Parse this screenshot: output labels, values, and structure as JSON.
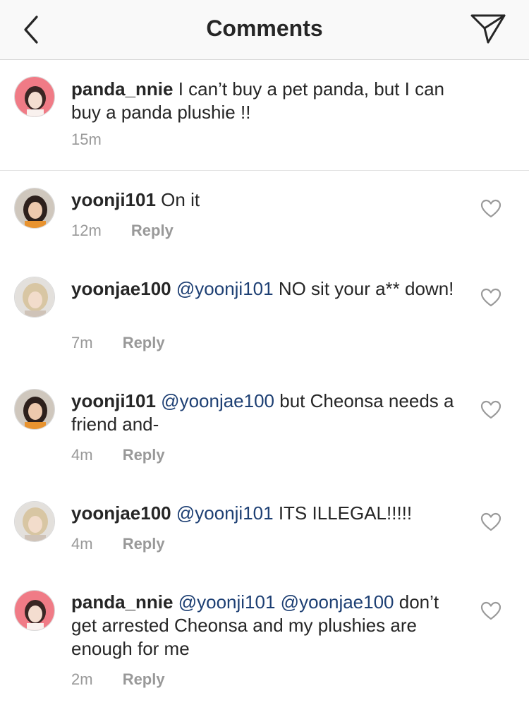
{
  "header": {
    "title": "Comments",
    "back_icon": "chevron-left-icon",
    "send_icon": "paper-plane-icon"
  },
  "caption": {
    "username": "panda_nnie",
    "text": "I can’t buy a pet panda, but I can buy a panda plushie !!",
    "time": "15m"
  },
  "comments": [
    {
      "username": "yoonji101",
      "mentions": [],
      "text": "On it",
      "time": "12m",
      "reply_label": "Reply"
    },
    {
      "username": "yoonjae100",
      "mentions": [
        "@yoonji101"
      ],
      "text": "NO sit your a** down!",
      "time": "7m",
      "reply_label": "Reply"
    },
    {
      "username": "yoonji101",
      "mentions": [
        "@yoonjae100"
      ],
      "text": "but Cheonsa needs a friend and-",
      "time": "4m",
      "reply_label": "Reply"
    },
    {
      "username": "yoonjae100",
      "mentions": [
        "@yoonji101"
      ],
      "text": "ITS ILLEGAL!!!!!",
      "time": "4m",
      "reply_label": "Reply"
    },
    {
      "username": "panda_nnie",
      "mentions": [
        "@yoonji101",
        "@yoonjae100"
      ],
      "text": "don’t get arrested Cheonsa and my plushies are enough for me",
      "time": "2m",
      "reply_label": "Reply"
    }
  ],
  "colors": {
    "mention": "#1d3f73",
    "meta": "#999999",
    "text": "#262626",
    "header_bg": "#f9f9f9"
  }
}
